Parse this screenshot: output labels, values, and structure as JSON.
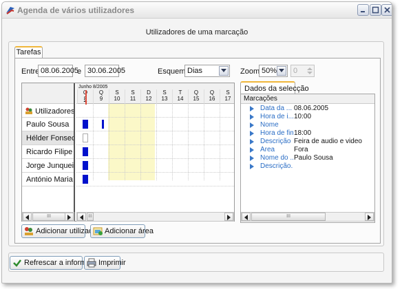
{
  "window": {
    "title": "Agenda de vários utilizadores"
  },
  "header": {
    "text": "Utilizadores de uma marcação"
  },
  "tabs": {
    "main": "Tarefas",
    "selection": "Dados da selecção"
  },
  "filters": {
    "entre_label": "Entre",
    "start_date": "08.06.2005",
    "e_label": "e",
    "end_date": "30.06.2005",
    "esquema_label": "Esquema",
    "esquema_value": "Dias",
    "zoom_label": "Zoom",
    "zoom_value": "50%",
    "spin_value": "0"
  },
  "calendar": {
    "month_label": "Junho 8/2005",
    "days": [
      {
        "letter": "Q",
        "num": "8"
      },
      {
        "letter": "Q",
        "num": "9"
      },
      {
        "letter": "S",
        "num": "10"
      },
      {
        "letter": "S",
        "num": "11"
      },
      {
        "letter": "D",
        "num": "12"
      },
      {
        "letter": "S",
        "num": "13"
      },
      {
        "letter": "T",
        "num": "14"
      },
      {
        "letter": "Q",
        "num": "15"
      },
      {
        "letter": "Q",
        "num": "16"
      },
      {
        "letter": "S",
        "num": "17"
      }
    ]
  },
  "users": {
    "header": "Utilizadores",
    "rows": [
      "Paulo Sousa",
      "Hélder Fonseca",
      "Ricardo Filipe d...",
      "Jorge Junqueira",
      "António Maria ..."
    ]
  },
  "properties": {
    "header": "Marcações",
    "rows": [
      {
        "key": "Data da ...",
        "value": "08.06.2005"
      },
      {
        "key": "Hora de i...",
        "value": "10:00"
      },
      {
        "key": "Nome",
        "value": ""
      },
      {
        "key": "Hora de fim",
        "value": "18:00"
      },
      {
        "key": "Descrição",
        "value": "Feira de audio e video"
      },
      {
        "key": "Área",
        "value": "Fora"
      },
      {
        "key": "Nome do ...",
        "value": "Paulo Sousa"
      },
      {
        "key": "Descrição...",
        "value": ""
      }
    ]
  },
  "buttons": {
    "add_user": "Adicionar utilizador",
    "add_area": "Adicionar área",
    "refresh": "Refrescar a informação",
    "print": "Imprimir"
  },
  "colors": {
    "appointment": "#0011cc",
    "weekend": "#fbf8c8",
    "tab_accent": "#f0b63a",
    "today": "#e04a3a"
  }
}
